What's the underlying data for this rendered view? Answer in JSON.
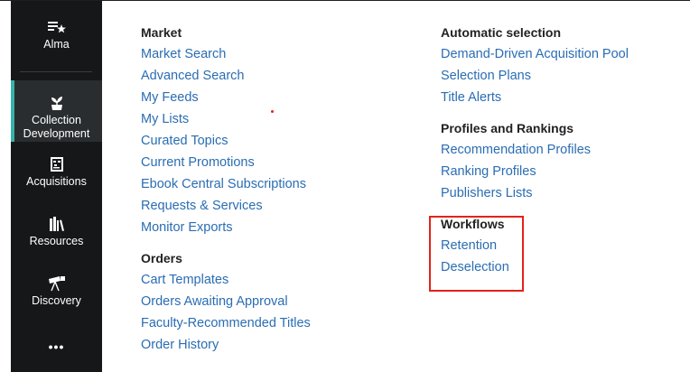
{
  "sidebar": {
    "items": [
      {
        "label": "Alma",
        "icon": "alma-star-icon"
      },
      {
        "label": "Collection Development",
        "icon": "seedling-icon",
        "active": true
      },
      {
        "label": "Acquisitions",
        "icon": "abacus-icon"
      },
      {
        "label": "Resources",
        "icon": "books-icon"
      },
      {
        "label": "Discovery",
        "icon": "telescope-icon"
      },
      {
        "label": "•••",
        "icon": "more-icon"
      }
    ],
    "accent_color": "#36b3a8",
    "background": "#151719"
  },
  "menu": {
    "market": {
      "title": "Market",
      "links": [
        "Market Search",
        "Advanced Search",
        "My Feeds",
        "My Lists",
        "Curated Topics",
        "Current Promotions",
        "Ebook Central Subscriptions",
        "Requests & Services",
        "Monitor Exports"
      ]
    },
    "orders": {
      "title": "Orders",
      "links": [
        "Cart Templates",
        "Orders Awaiting Approval",
        "Faculty-Recommended Titles",
        "Order History"
      ]
    },
    "automatic_selection": {
      "title": "Automatic selection",
      "links": [
        "Demand-Driven Acquisition Pool",
        "Selection Plans",
        "Title Alerts"
      ]
    },
    "profiles": {
      "title": "Profiles and Rankings",
      "links": [
        "Recommendation Profiles",
        "Ranking Profiles",
        "Publishers Lists"
      ]
    },
    "workflows": {
      "title": "Workflows",
      "links": [
        "Retention",
        "Deselection"
      ],
      "highlight_color": "#e2231a"
    }
  },
  "colors": {
    "link": "#2a6db3",
    "heading": "#222222"
  }
}
